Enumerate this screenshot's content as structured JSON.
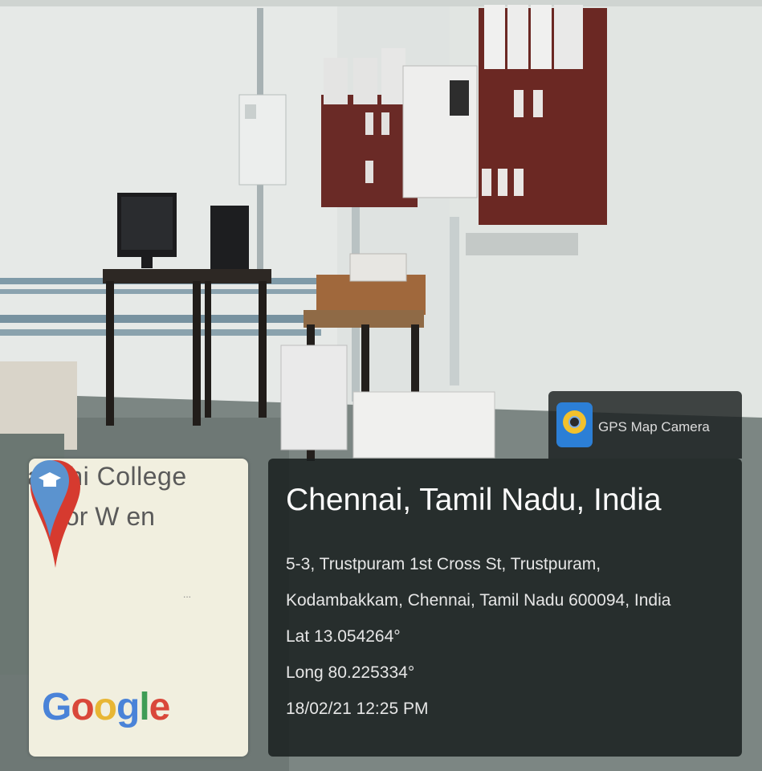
{
  "photo": {
    "description_free": true
  },
  "app_badge": {
    "name": "GPS Map Camera",
    "icon": "gps-map-camera-icon"
  },
  "map_thumbnail": {
    "label_line_1": "akshi College",
    "label_line_2": "for W    en",
    "ellipsis": "...",
    "logo_text": [
      "G",
      "o",
      "o",
      "g",
      "l",
      "e"
    ],
    "pin_icon": "map-pin-icon",
    "poi_icon": "graduation-cap-icon"
  },
  "location": {
    "title": "Chennai, Tamil Nadu, India",
    "address_line_1": "5-3, Trustpuram 1st Cross St, Trustpuram,",
    "address_line_2": "Kodambakkam, Chennai, Tamil Nadu 600094, India",
    "lat": "Lat 13.054264°",
    "long": "Long 80.225334°",
    "timestamp": "18/02/21 12:25 PM"
  },
  "colors": {
    "overlay": "#1a1f1f",
    "pin_red": "#d63a2f",
    "poi_blue": "#5b93cf"
  }
}
